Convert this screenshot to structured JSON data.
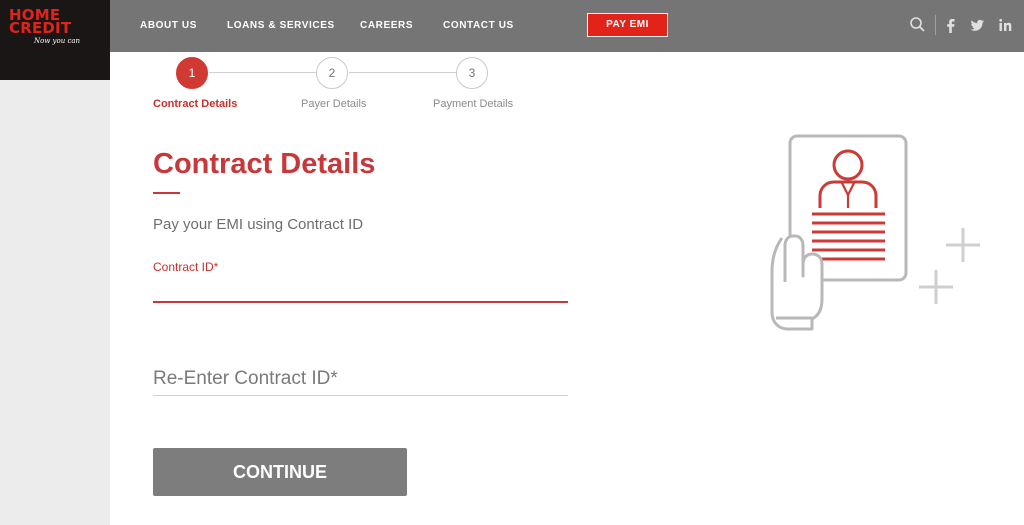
{
  "brand": {
    "line1": "HOME",
    "line2": "CREDIT",
    "tagline": "Now you can",
    "colors": {
      "primary": "#e2231a",
      "title": "#c6383a",
      "topbar": "#757575",
      "button": "#7d7d7d"
    }
  },
  "nav": {
    "items": [
      "ABOUT US",
      "LOANS & SERVICES",
      "CAREERS",
      "CONTACT US"
    ],
    "cta": "PAY EMI",
    "icons": [
      "search-icon",
      "facebook-icon",
      "twitter-icon",
      "linkedin-icon"
    ]
  },
  "stepper": {
    "steps": [
      {
        "number": "1",
        "label": "Contract Details",
        "active": true
      },
      {
        "number": "2",
        "label": "Payer Details",
        "active": false
      },
      {
        "number": "3",
        "label": "Payment Details",
        "active": false
      }
    ]
  },
  "form": {
    "title": "Contract Details",
    "subtitle": "Pay your EMI using Contract ID",
    "contract_id_label": "Contract ID*",
    "contract_id_value": "",
    "reenter_placeholder": "Re-Enter Contract ID*",
    "continue_label": "CONTINUE"
  },
  "illustration": {
    "icon": "contract-document-icon"
  }
}
